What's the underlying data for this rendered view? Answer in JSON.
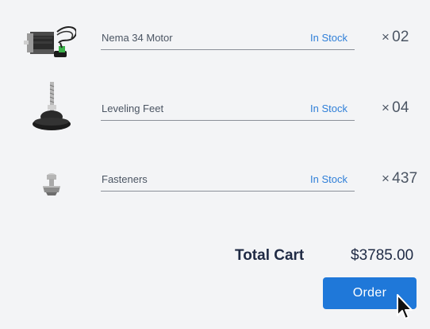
{
  "cart": {
    "items": [
      {
        "name": "Nema 34 Motor",
        "status": "In Stock",
        "qty_prefix": "×",
        "qty": "02",
        "image_icon": "stepper-motor-icon"
      },
      {
        "name": "Leveling Feet",
        "status": "In Stock",
        "qty_prefix": "×",
        "qty": "04",
        "image_icon": "leveling-foot-icon"
      },
      {
        "name": "Fasteners",
        "status": "In Stock",
        "qty_prefix": "×",
        "qty": "437",
        "image_icon": "t-nut-fastener-icon"
      }
    ],
    "total_label": "Total Cart",
    "total_value": "$3785.00",
    "order_label": "Order"
  },
  "colors": {
    "background": "#f3f4f6",
    "status": "#2f7fd8",
    "accent_button": "#1f78d9",
    "text_dark": "#1f2a44",
    "text_body": "#4b5563"
  },
  "cursor_icon": "mouse-pointer-icon"
}
